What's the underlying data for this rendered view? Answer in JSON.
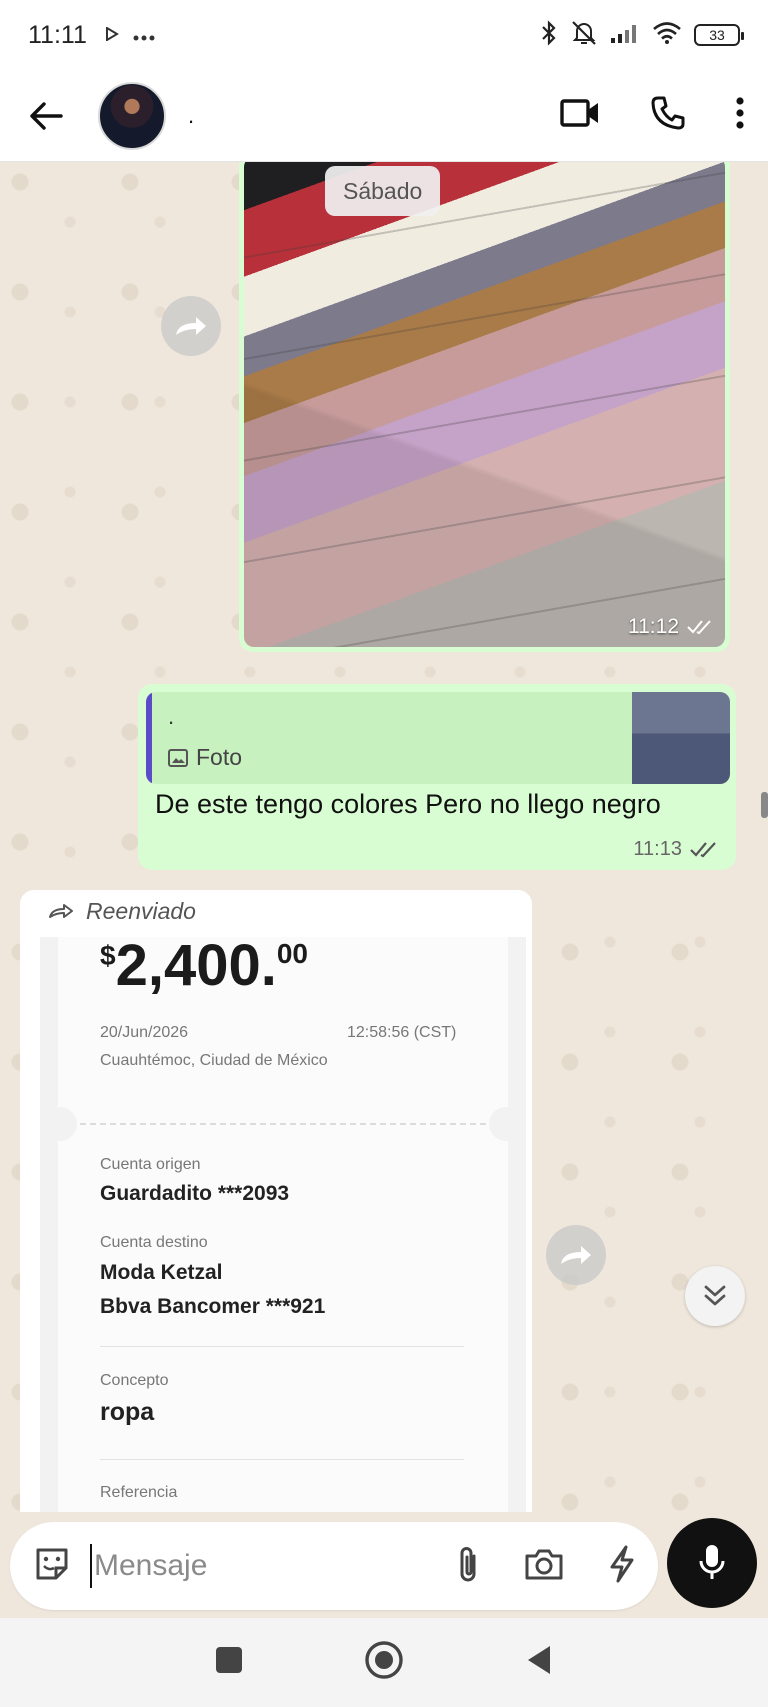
{
  "status_bar": {
    "time": "11:11",
    "battery": "33"
  },
  "header": {
    "contact_name": "."
  },
  "chat": {
    "date_chip": "Sábado",
    "photo_message": {
      "time": "11:12"
    },
    "reply_message": {
      "quoted_author": ".",
      "quoted_kind": "Foto",
      "text": "De este tengo colores Pero no llego negro",
      "time": "11:13"
    },
    "forwarded_message": {
      "forward_label": "Reenviado",
      "receipt": {
        "currency_symbol": "$",
        "amount_int": "2,400.",
        "amount_dec": "00",
        "date": "20/Jun/2026",
        "time": "12:58:56 (CST)",
        "location": "Cuauhtémoc, Ciudad de México",
        "origin_label": "Cuenta origen",
        "origin_value": "Guardadito ***2093",
        "dest_label": "Cuenta destino",
        "dest_name": "Moda Ketzal",
        "dest_bank": "Bbva Bancomer ***921",
        "concept_label": "Concepto",
        "concept_value": "ropa",
        "reference_label": "Referencia"
      }
    }
  },
  "composer": {
    "placeholder": "Mensaje"
  },
  "colors": {
    "bubble_out": "#d9fdd3",
    "quote_bar": "#5b4bc8",
    "chat_bg": "#efe7dc",
    "read_ticks": "#666666"
  }
}
